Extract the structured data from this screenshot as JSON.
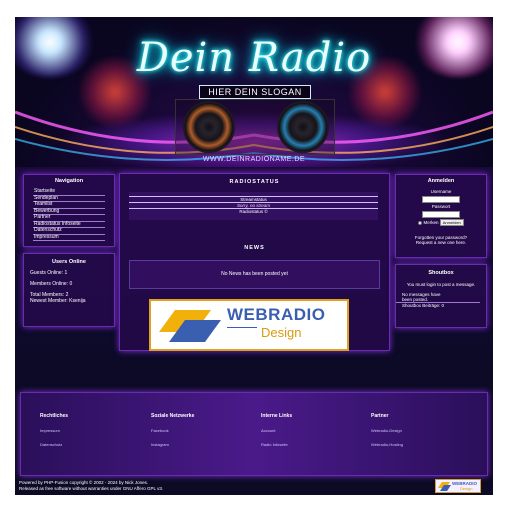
{
  "header": {
    "title": "Dein Radio",
    "slogan": "HIER DEIN SLOGAN",
    "url": "WWW.DEINRADIONAME.DE"
  },
  "navigation": {
    "title": "Navigation",
    "items": [
      "Startseite",
      "Sendeplan",
      "Teamlist",
      "Bewerbung",
      "Partner",
      "Radiostatus Infoseite",
      "Datenschutz",
      "Impressum"
    ]
  },
  "users_online": {
    "title": "Users Online",
    "guests": "Guests Online: 1",
    "members": "Members Online: 0",
    "total": "Total Members: 2",
    "newest": "Newest Member: Ksenija"
  },
  "radiostatus": {
    "title": "RADIOSTATUS",
    "stream_label": "Streamstatus",
    "stream_value": "Sorry, no stream",
    "radiostatus_label": "Radiostatus ©"
  },
  "news": {
    "title": "NEWS",
    "empty": "No News has been posted yet"
  },
  "banner_logo": {
    "word1": "WEBRADIO",
    "word2": "Design"
  },
  "login": {
    "title": "Anmelden",
    "username_label": "Username",
    "password_label": "Passwort",
    "remember_label": "Merken",
    "submit_label": "Anmelden",
    "forgot": "Forgotten your password?",
    "request": "Request a new one here."
  },
  "shoutbox": {
    "title": "Shoutbox",
    "login_note": "You must login to post a message.",
    "no_messages": "No messages have been posted.",
    "archive": "Shoutbox Beiträge: 0"
  },
  "footer": {
    "columns": [
      {
        "title": "Rechtliches",
        "links": [
          "Impressum",
          "Datenschutz"
        ]
      },
      {
        "title": "Soziale Netzwerke",
        "links": [
          "Facebook",
          "Instagram"
        ]
      },
      {
        "title": "Interne Links",
        "links": [
          "Account",
          "Radio Infoseite"
        ]
      },
      {
        "title": "Partner",
        "links": [
          "Webradio-Design",
          "Webradio-Hosting"
        ]
      }
    ],
    "powered_line1": "Powered by PHP-Fusion copyright © 2002 - 2024 by Nick Jones.",
    "powered_line2": "Released as free software without warranties under GNU Affero GPL v3.",
    "mini_logo_word1": "WEBRADIO",
    "mini_logo_word2": "Design"
  },
  "colors": {
    "accent": "#7d2ed4",
    "neon": "#00ffff",
    "logo_blue": "#3a5fb0",
    "logo_gold": "#f2b10a"
  }
}
